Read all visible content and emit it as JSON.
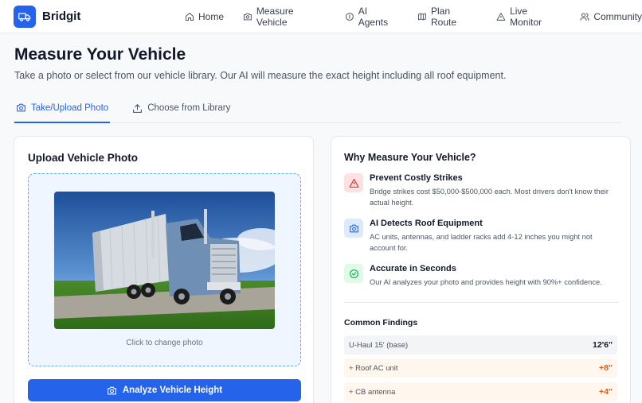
{
  "brand": {
    "name": "Bridgit"
  },
  "nav": {
    "items": [
      {
        "label": "Home",
        "icon": "home-icon"
      },
      {
        "label": "Measure Vehicle",
        "icon": "camera-icon"
      },
      {
        "label": "AI Agents",
        "icon": "info-circle-icon"
      },
      {
        "label": "Plan Route",
        "icon": "map-icon"
      },
      {
        "label": "Live Monitor",
        "icon": "warning-triangle-icon"
      },
      {
        "label": "Community",
        "icon": "users-icon"
      }
    ]
  },
  "header": {
    "title": "Measure Your Vehicle",
    "subtitle": "Take a photo or select from our vehicle library. Our AI will measure the exact height including all roof equipment."
  },
  "tabs": [
    {
      "label": "Take/Upload Photo",
      "icon": "camera-icon",
      "active": true
    },
    {
      "label": "Choose from Library",
      "icon": "upload-icon",
      "active": false
    }
  ],
  "upload": {
    "title": "Upload Vehicle Photo",
    "caption": "Click to change photo",
    "analyze_label": "Analyze Vehicle Height"
  },
  "why": {
    "title": "Why Measure Your Vehicle?",
    "items": [
      {
        "heading": "Prevent Costly Strikes",
        "desc": "Bridge strikes cost $50,000-$500,000 each. Most drivers don't know their actual height.",
        "icon": "alert-triangle-icon",
        "color": "#dc2626"
      },
      {
        "heading": "AI Detects Roof Equipment",
        "desc": "AC units, antennas, and ladder racks add 4-12 inches you might not account for.",
        "icon": "camera-icon",
        "color": "#2563eb"
      },
      {
        "heading": "Accurate in Seconds",
        "desc": "Our AI analyzes your photo and provides height with 90%+ confidence.",
        "icon": "check-circle-icon",
        "color": "#16a34a"
      }
    ]
  },
  "findings": {
    "title": "Common Findings",
    "rows": [
      {
        "label": "U-Haul 15' (base)",
        "value": "12'6\""
      },
      {
        "label": "+ Roof AC unit",
        "value": "+8\""
      },
      {
        "label": "+ CB antenna",
        "value": "+4\""
      }
    ]
  },
  "colors": {
    "accent": "#2563eb",
    "warning": "#ea580c"
  }
}
